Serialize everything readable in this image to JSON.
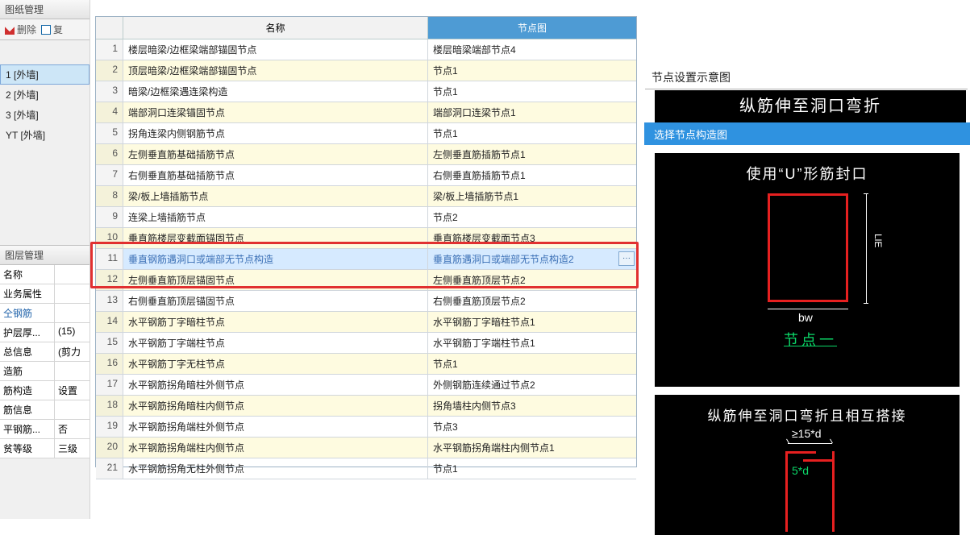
{
  "leftPanel": {
    "header": "图纸管理",
    "toolbar": {
      "delete": "删除",
      "copy": "复"
    },
    "items": [
      "1 [外墙]",
      "2 [外墙]",
      "3 [外墙]",
      "YT [外墙]"
    ],
    "selectedIndex": 0
  },
  "layerPanel": {
    "header": "图层管理",
    "colName": "名称",
    "rows": [
      {
        "k": "业务属性",
        "v": ""
      },
      {
        "k": "仝钢筋",
        "v": "",
        "klass": "prop-blue"
      },
      {
        "k": "护层厚...",
        "v": "(15)"
      },
      {
        "k": "总信息",
        "v": "(剪力"
      },
      {
        "k": "造筋",
        "v": ""
      },
      {
        "k": "筋构造",
        "v": "设置"
      },
      {
        "k": "筋信息",
        "v": ""
      },
      {
        "k": "平钢筋...",
        "v": "否"
      },
      {
        "k": "贫等级",
        "v": "三级"
      }
    ]
  },
  "table": {
    "col1": "名称",
    "col2": "节点图",
    "rows": [
      {
        "n": "1",
        "name": "楼层暗梁/边框梁端部锚固节点",
        "node": "楼层暗梁端部节点4"
      },
      {
        "n": "2",
        "name": "顶层暗梁/边框梁端部锚固节点",
        "node": "节点1"
      },
      {
        "n": "3",
        "name": "暗梁/边框梁遇连梁构造",
        "node": "节点1"
      },
      {
        "n": "4",
        "name": "端部洞口连梁锚固节点",
        "node": "端部洞口连梁节点1"
      },
      {
        "n": "5",
        "name": "拐角连梁内侧钢筋节点",
        "node": "节点1"
      },
      {
        "n": "6",
        "name": "左侧垂直筋基础插筋节点",
        "node": "左侧垂直筋插筋节点1"
      },
      {
        "n": "7",
        "name": "右侧垂直筋基础插筋节点",
        "node": "右侧垂直筋插筋节点1"
      },
      {
        "n": "8",
        "name": "梁/板上墙插筋节点",
        "node": "梁/板上墙插筋节点1"
      },
      {
        "n": "9",
        "name": "连梁上墙插筋节点",
        "node": "节点2"
      },
      {
        "n": "10",
        "name": "垂直筋楼层变截面锚固节点",
        "node": "垂直筋楼层变截面节点3"
      },
      {
        "n": "11",
        "name": "垂直钢筋遇洞口或端部无节点构造",
        "node": "垂直筋遇洞口或端部无节点构造2",
        "active": true
      },
      {
        "n": "12",
        "name": "左侧垂直筋顶层锚固节点",
        "node": "左侧垂直筋顶层节点2"
      },
      {
        "n": "13",
        "name": "右侧垂直筋顶层锚固节点",
        "node": "右侧垂直筋顶层节点2"
      },
      {
        "n": "14",
        "name": "水平钢筋丁字暗柱节点",
        "node": "水平钢筋丁字暗柱节点1"
      },
      {
        "n": "15",
        "name": "水平钢筋丁字端柱节点",
        "node": "水平钢筋丁字端柱节点1"
      },
      {
        "n": "16",
        "name": "水平钢筋丁字无柱节点",
        "node": "节点1"
      },
      {
        "n": "17",
        "name": "水平钢筋拐角暗柱外侧节点",
        "node": "外侧钢筋连续通过节点2"
      },
      {
        "n": "18",
        "name": "水平钢筋拐角暗柱内侧节点",
        "node": "拐角墙柱内侧节点3"
      },
      {
        "n": "19",
        "name": "水平钢筋拐角端柱外侧节点",
        "node": "节点3"
      },
      {
        "n": "20",
        "name": "水平钢筋拐角端柱内侧节点",
        "node": "水平钢筋拐角端柱内侧节点1"
      },
      {
        "n": "21",
        "name": "水平钢筋拐角无柱外侧节点",
        "node": "节点1"
      }
    ]
  },
  "right": {
    "diagramHeader": "节点设置示意图",
    "cutTitle": "纵筋伸至洞口弯折",
    "selectTitle": "选择节点构造图",
    "thumb1": {
      "title": "使用“U”形筋封口",
      "bw": "bw",
      "lae": "LlE",
      "link": "节点一"
    },
    "thumb2": {
      "title": "纵筋伸至洞口弯折且相互搭接",
      "d15": "≥15*d",
      "d5": "5*d"
    }
  },
  "misc": {
    "ellipsis": "···"
  }
}
